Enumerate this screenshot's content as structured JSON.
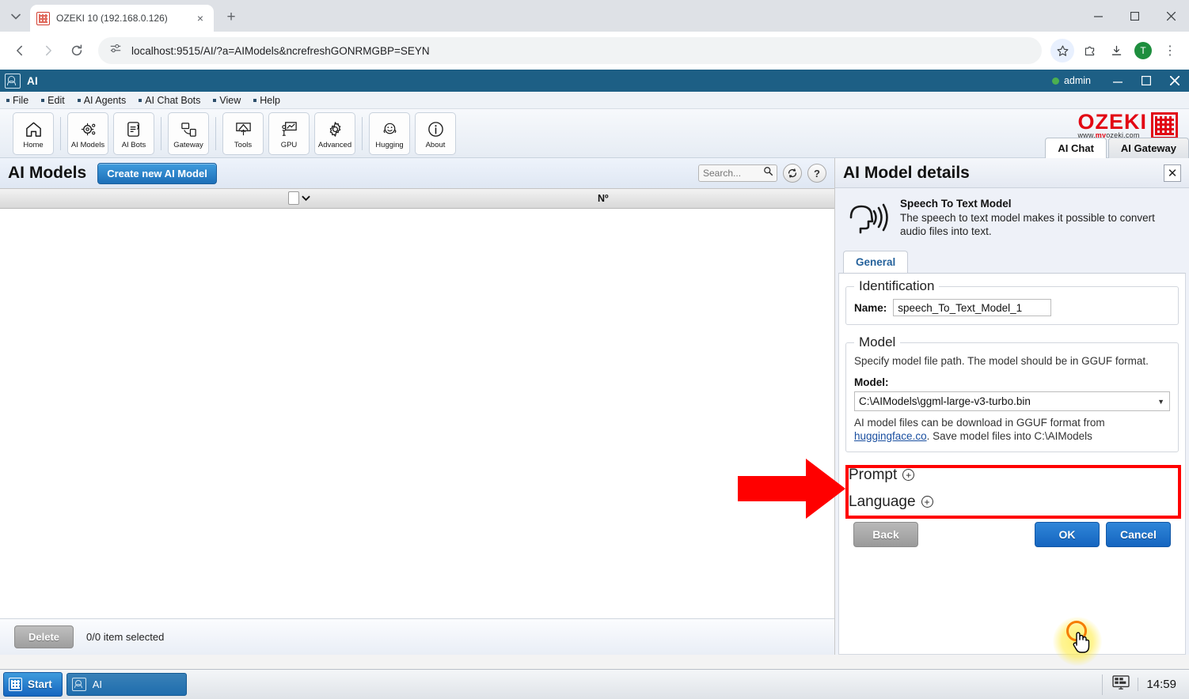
{
  "browser": {
    "tab": {
      "title": "OZEKI 10 (192.168.0.126)",
      "favicon": "ozeki-favicon",
      "close": "×"
    },
    "new_tab": "+",
    "nav": {
      "back": "←",
      "forward": "→",
      "reload": "⟳"
    },
    "url": "localhost:9515/AI/?a=AIModels&ncrefreshGONRMGBP=SEYN",
    "actions": {
      "bookmark": "star-icon",
      "extensions": "extensions-icon",
      "downloads": "download-icon",
      "profile": "T",
      "menu": "⋮"
    },
    "window": {
      "minimize": "–",
      "maximize": "□",
      "close": "✕"
    }
  },
  "app": {
    "title": "AI",
    "user": "admin",
    "window_buttons": {
      "minimize": "–",
      "maximize": "❐",
      "close": "✕"
    },
    "menu": [
      "File",
      "Edit",
      "AI Agents",
      "AI Chat Bots",
      "View",
      "Help"
    ],
    "ribbon_groups": [
      {
        "buttons": [
          {
            "label": "Home",
            "icon": "home-icon"
          }
        ]
      },
      {
        "buttons": [
          {
            "label": "AI Models",
            "icon": "gear-network-icon"
          },
          {
            "label": "AI Bots",
            "icon": "bot-device-icon"
          }
        ]
      },
      {
        "buttons": [
          {
            "label": "Gateway",
            "icon": "gateway-icon"
          }
        ]
      },
      {
        "buttons": [
          {
            "label": "Tools",
            "icon": "tools-icon"
          },
          {
            "label": "GPU",
            "icon": "gpu-chart-icon"
          },
          {
            "label": "Advanced",
            "icon": "gear-icon"
          }
        ]
      },
      {
        "buttons": [
          {
            "label": "Hugging",
            "icon": "hugging-face-icon"
          },
          {
            "label": "About",
            "icon": "info-icon"
          }
        ]
      }
    ],
    "brand": {
      "name": "OZEKI",
      "url_prefix": "www.",
      "url_mid": "my",
      "url_suffix": "ozeki.com"
    },
    "tabs": [
      {
        "label": "AI Chat",
        "active": true
      },
      {
        "label": "AI Gateway",
        "active": false
      }
    ]
  },
  "models_list": {
    "title": "AI Models",
    "create_button": "Create new AI Model",
    "search_placeholder": "Search...",
    "search_value": "",
    "refresh_icon": "refresh-icon",
    "help_icon": "help-icon",
    "columns": [
      {
        "label": "",
        "type": "checkbox"
      },
      {
        "label": "Nº"
      }
    ],
    "rows": [],
    "delete_button": "Delete",
    "selection_status": "0/0 item selected"
  },
  "details": {
    "title": "AI Model details",
    "close": "✕",
    "hero": {
      "icon": "speech-to-text-icon",
      "heading": "Speech To Text Model",
      "description": "The speech to text model makes it possible to convert audio files into text."
    },
    "tab_general": "General",
    "identification": {
      "legend": "Identification",
      "name_label": "Name:",
      "name_value": "speech_To_Text_Model_1"
    },
    "model": {
      "legend": "Model",
      "hint_top": "Specify model file path. The model should be in GGUF format.",
      "field_label": "Model:",
      "selected": "C:\\AIModels\\ggml-large-v3-turbo.bin",
      "options": [
        "C:\\AIModels\\ggml-large-v3-turbo.bin"
      ],
      "hint_bottom_pre": "AI model files can be download in GGUF format from ",
      "hint_link": "huggingface.co",
      "hint_bottom_post": ". Save model files into C:\\AIModels"
    },
    "collapsed_sections": [
      {
        "label": "Prompt",
        "expander": "+"
      },
      {
        "label": "Language",
        "expander": "+"
      }
    ],
    "buttons": {
      "back": "Back",
      "ok": "OK",
      "cancel": "Cancel"
    }
  },
  "annotations": {
    "arrow_color": "#ff0000",
    "highlight_box_color": "#ff0000",
    "highlight_target": "model-select"
  },
  "taskbar": {
    "start": "Start",
    "items": [
      {
        "label": "AI",
        "icon": "ozeki-ai-icon"
      }
    ],
    "tray_icon": "display-icon",
    "clock": "14:59"
  }
}
